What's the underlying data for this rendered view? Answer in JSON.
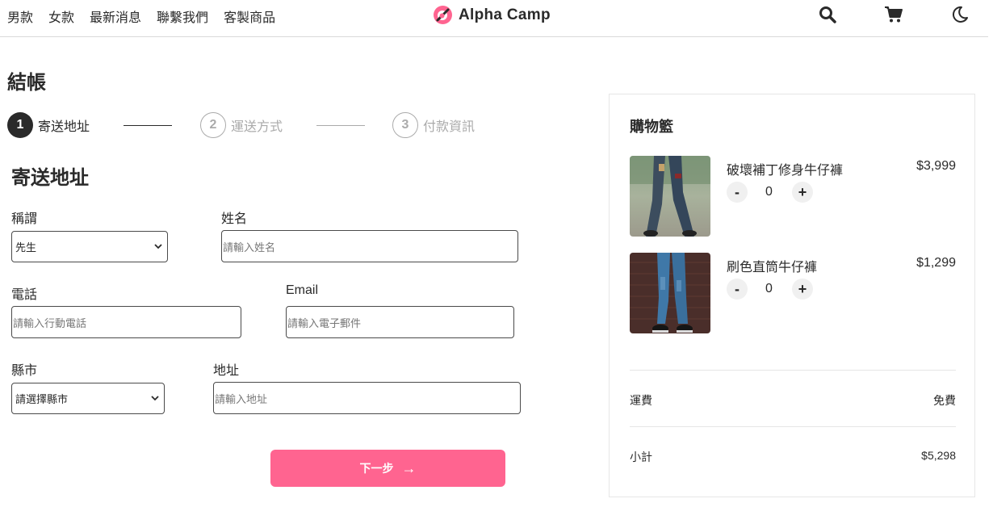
{
  "header": {
    "nav": [
      "男款",
      "女款",
      "最新消息",
      "聯繫我們",
      "客製商品"
    ],
    "logo_text": "Alpha Camp",
    "icons": [
      "search-icon",
      "cart-icon",
      "moon-icon"
    ]
  },
  "page_title": "結帳",
  "stepper": [
    {
      "num": "1",
      "label": "寄送地址",
      "state": "active"
    },
    {
      "num": "2",
      "label": "運送方式",
      "state": "inactive"
    },
    {
      "num": "3",
      "label": "付款資訊",
      "state": "inactive"
    }
  ],
  "form": {
    "section_title": "寄送地址",
    "salutation": {
      "label": "稱謂",
      "value": "先生"
    },
    "name": {
      "label": "姓名",
      "placeholder": "請輸入姓名"
    },
    "phone": {
      "label": "電話",
      "placeholder": "請輸入行動電話"
    },
    "email": {
      "label": "Email",
      "placeholder": "請輸入電子郵件"
    },
    "city": {
      "label": "縣市",
      "value": "請選擇縣市"
    },
    "address": {
      "label": "地址",
      "placeholder": "請輸入地址"
    },
    "next_label": "下一步",
    "next_arrow": "→"
  },
  "cart": {
    "title": "購物籃",
    "items": [
      {
        "name": "破壞補丁修身牛仔褲",
        "price": "$3,999",
        "qty": "0",
        "minus": "-",
        "plus": "+"
      },
      {
        "name": "刷色直筒牛仔褲",
        "price": "$1,299",
        "qty": "0",
        "minus": "-",
        "plus": "+"
      }
    ],
    "shipping_label": "運費",
    "shipping_value": "免費",
    "subtotal_label": "小計",
    "subtotal_value": "$5,298"
  },
  "colors": {
    "accent": "#ff6490",
    "text": "#2a2a2a",
    "muted": "#aaaaaa"
  }
}
